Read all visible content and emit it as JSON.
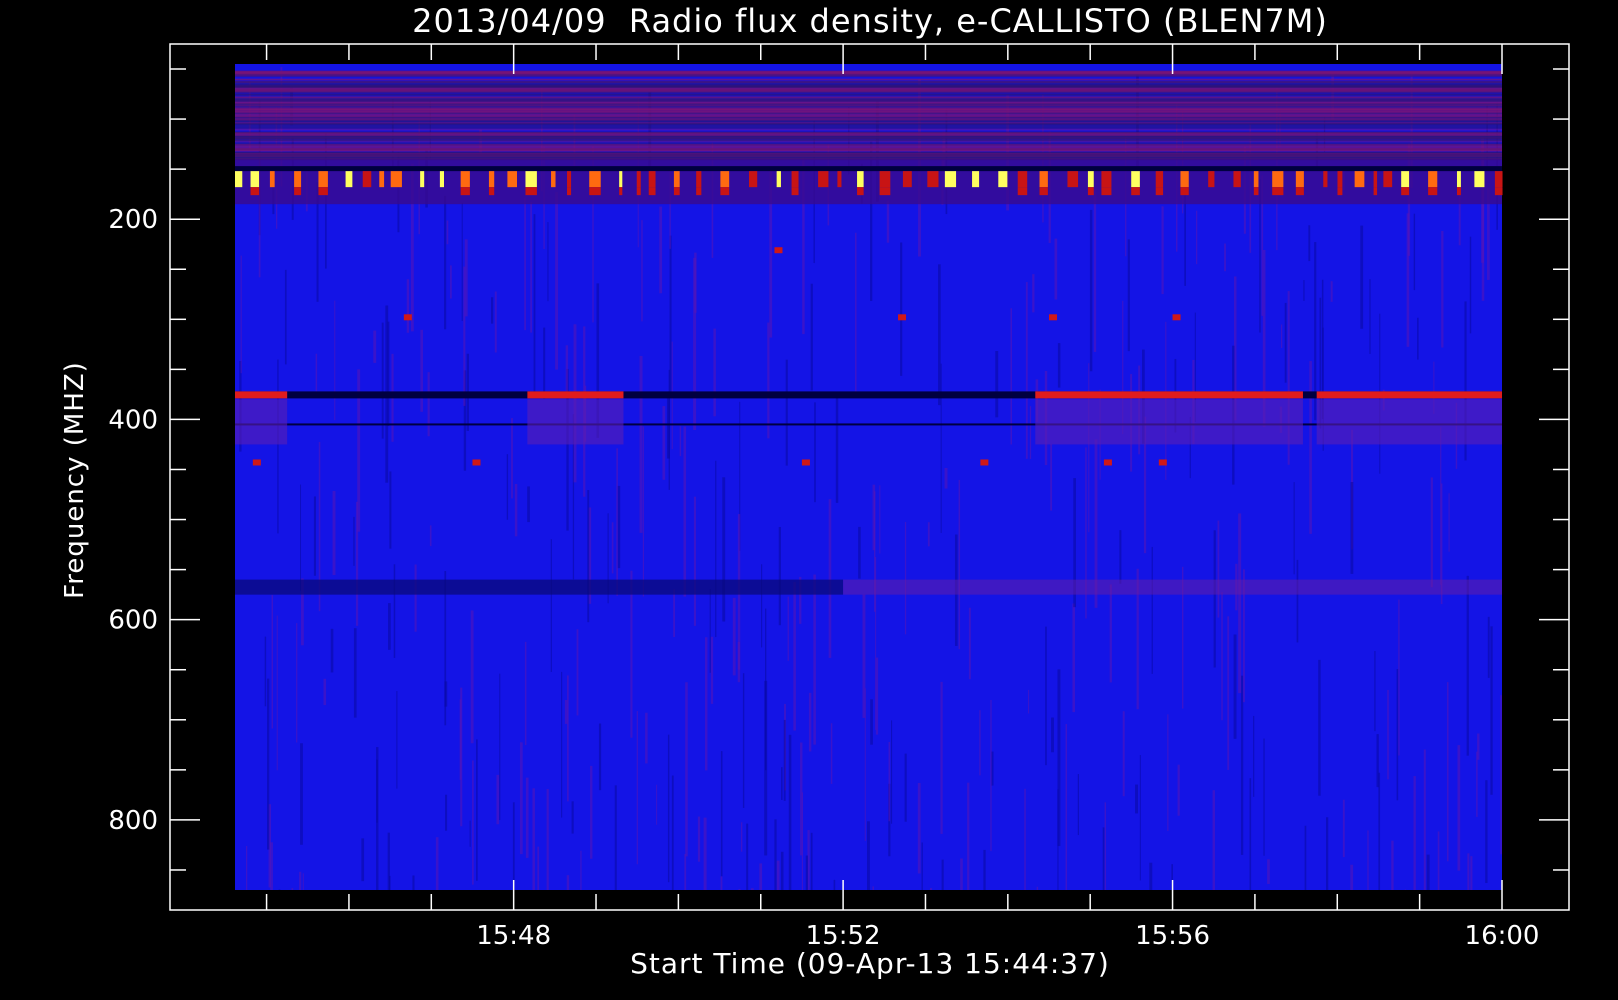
{
  "chart_data": {
    "type": "heatmap",
    "title": "2013/04/09  Radio flux density, e-CALLISTO (BLEN7M)",
    "xlabel": "Start Time (09-Apr-13 15:44:37)",
    "ylabel": "Frequency (MHZ)",
    "x_tick_labels": [
      "15:48",
      "15:52",
      "15:56",
      "16:00"
    ],
    "y_tick_labels": [
      "200",
      "400",
      "600",
      "800"
    ],
    "x_range": [
      "15:44:37",
      "16:00:00"
    ],
    "y_range_mhz": [
      45,
      870
    ],
    "y_axis_inverted": true,
    "colormap": "blue-red-yellow",
    "colors": {
      "background": "#1414e6",
      "low": "#000040",
      "mid": "#c81414",
      "high": "#ffff60"
    },
    "features": [
      {
        "kind": "bursty band",
        "freq_mhz": [
          140,
          185
        ],
        "time": [
          "15:44:37",
          "16:00:00"
        ]
      },
      {
        "kind": "intermittent line",
        "freq_mhz": [
          372,
          378
        ],
        "segments": [
          [
            "15:44:37",
            "15:45:15"
          ],
          [
            "15:48:10",
            "15:49:20"
          ],
          [
            "15:54:20",
            "15:57:35"
          ],
          [
            "15:57:45",
            "16:00:00"
          ]
        ]
      },
      {
        "kind": "dark band",
        "freq_mhz": [
          560,
          575
        ],
        "time": [
          "15:44:37",
          "15:52:00"
        ]
      }
    ]
  }
}
